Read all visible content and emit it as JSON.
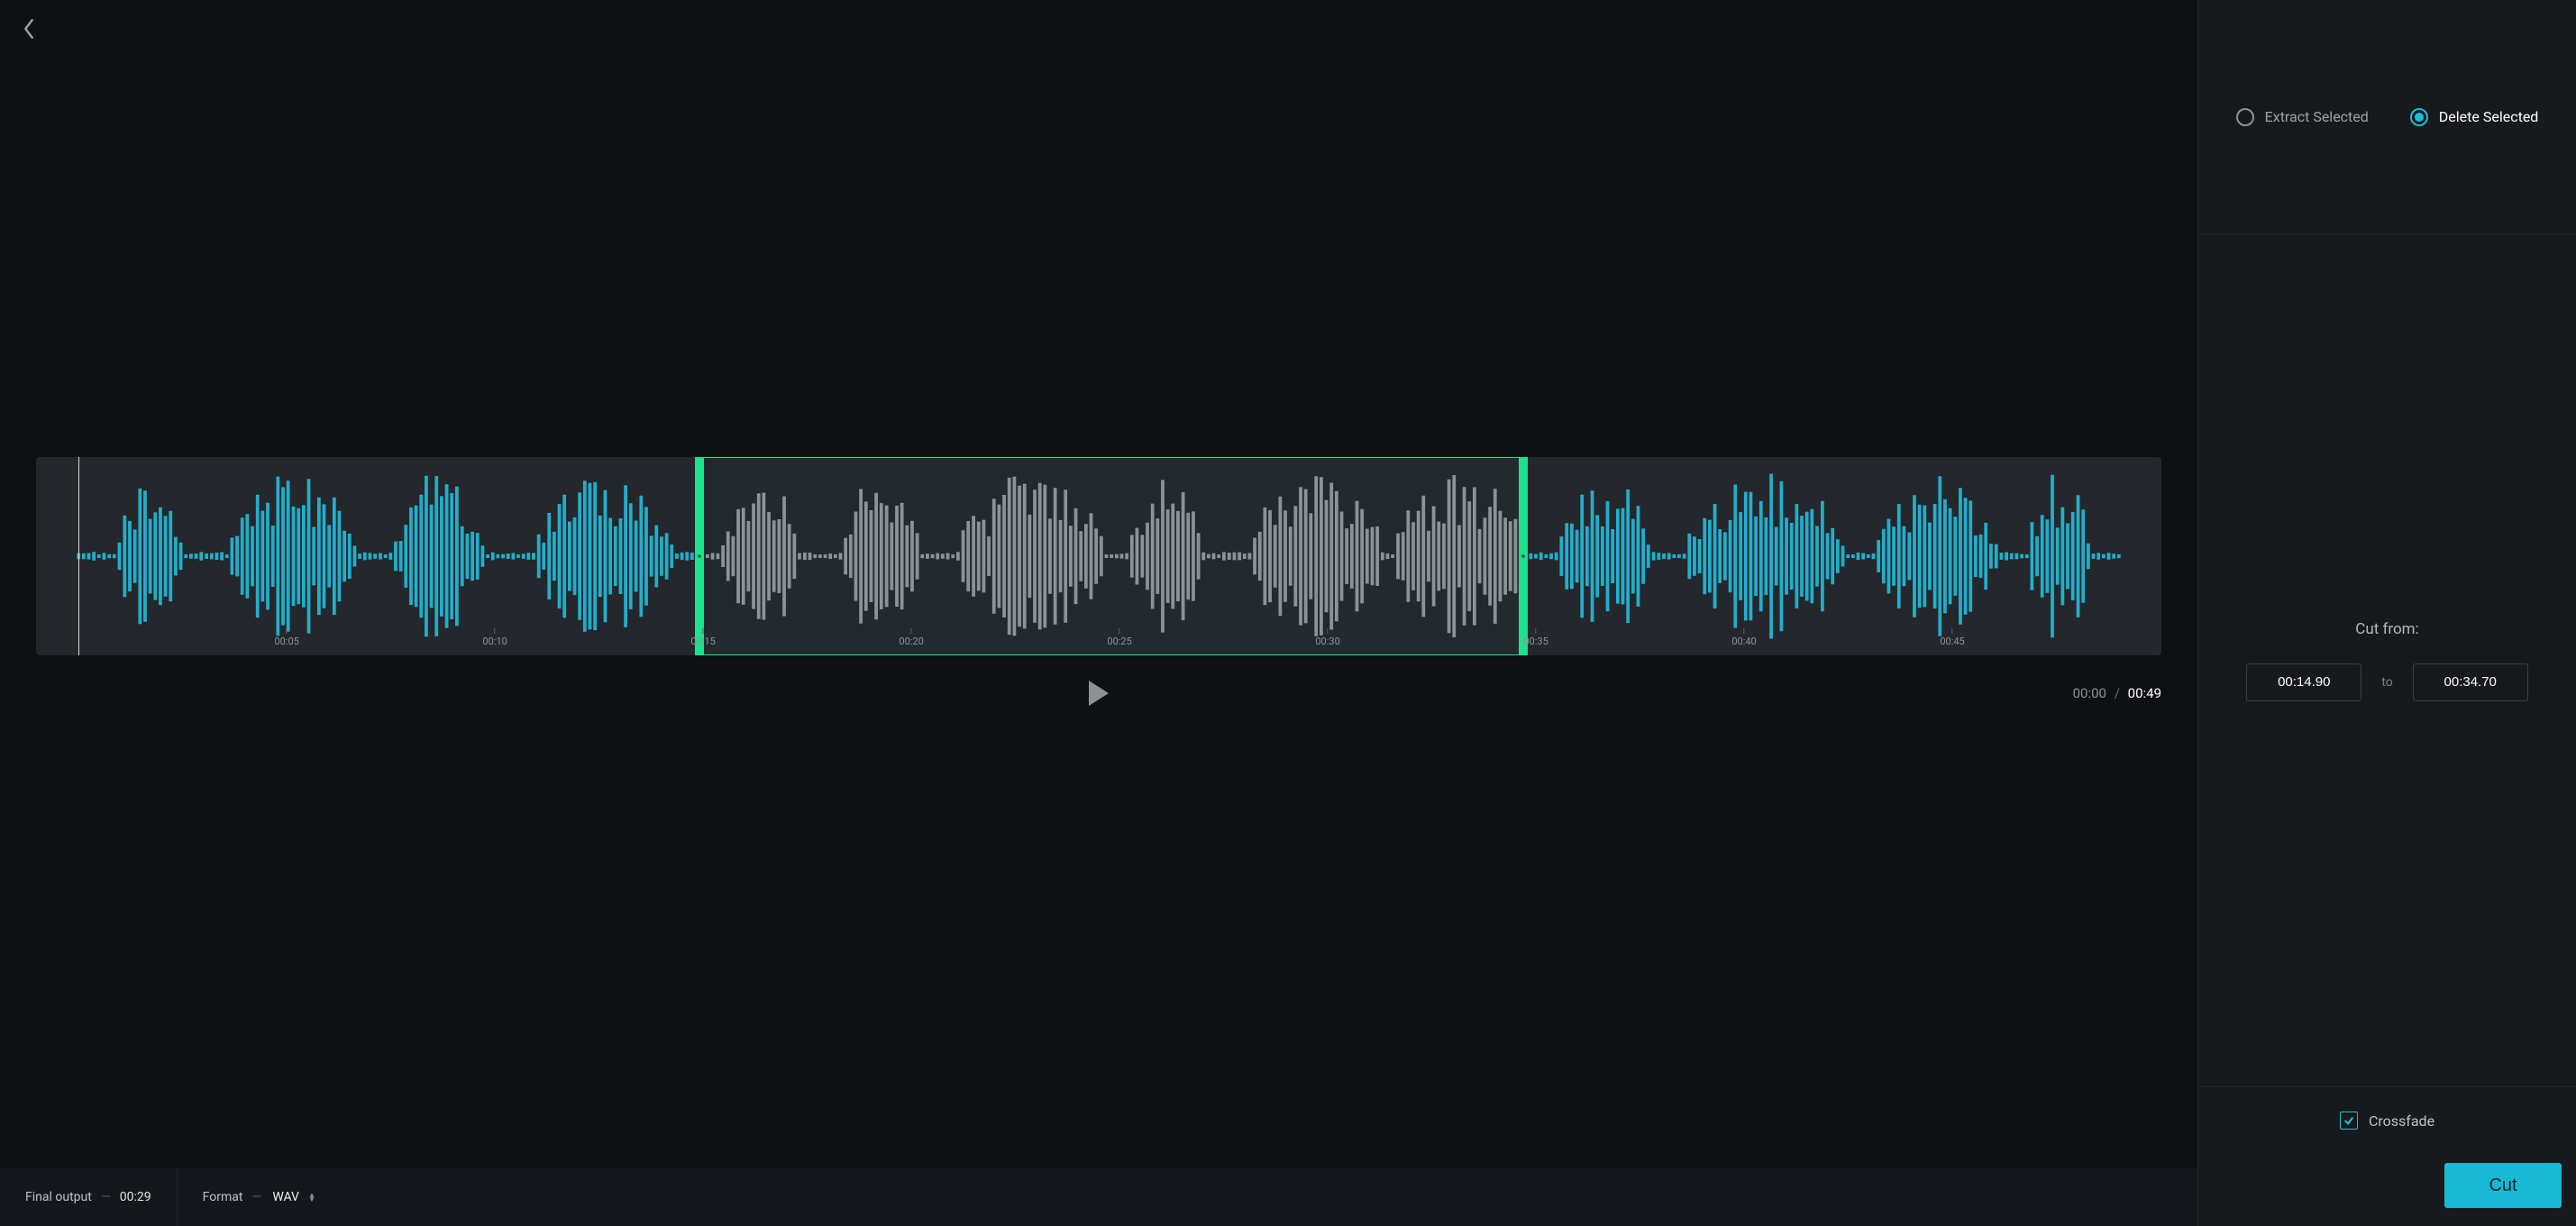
{
  "colors": {
    "accent_green": "#19e38b",
    "accent_cyan": "#16c0d6",
    "wave_active": "#22aecb",
    "wave_muted": "#8e9297"
  },
  "transport": {
    "current_time": "00:00",
    "total_time": "00:49"
  },
  "timeline": {
    "total_seconds": 49,
    "ticks": [
      "00:05",
      "00:10",
      "00:15",
      "00:20",
      "00:25",
      "00:30",
      "00:35",
      "00:40",
      "00:45"
    ]
  },
  "selection": {
    "start_seconds": 14.9,
    "end_seconds": 34.7,
    "start_label": "00:14.90",
    "end_label": "00:34.70"
  },
  "side_panel": {
    "mode_extract_label": "Extract Selected",
    "mode_delete_label": "Delete Selected",
    "mode_checked": "delete",
    "cut_from_label": "Cut from:",
    "to_label": "to",
    "crossfade_label": "Crossfade",
    "crossfade_checked": true,
    "cut_button_label": "Cut"
  },
  "bottom_bar": {
    "final_output_label": "Final output",
    "final_output_value": "00:29",
    "format_label": "Format",
    "format_value": "WAV"
  }
}
